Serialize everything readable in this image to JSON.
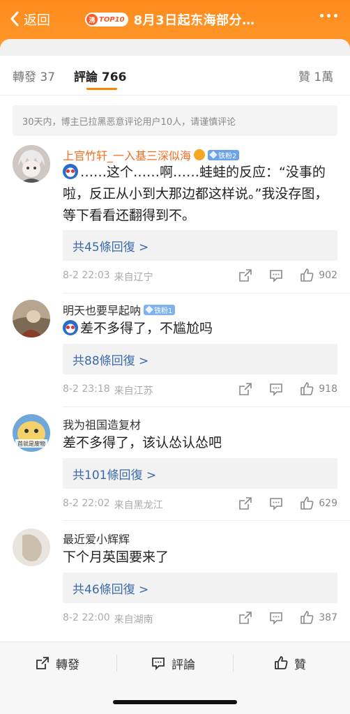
{
  "header": {
    "back_label": "返回",
    "hot_tag": "沸",
    "top10_label": "TOP10",
    "title": "8月3日起东海部分…",
    "colors": {
      "accent": "#ff8a1c"
    }
  },
  "tabs": [
    {
      "label": "轉發 37"
    },
    {
      "label": "評論 766"
    },
    {
      "label": "贊 1萬"
    }
  ],
  "notice": "30天内，博主已拉黑恶意评论用户10人，请谨慎评论",
  "comments": [
    {
      "username": "上官竹轩_一入基三深似海",
      "username_color": "#f36f21",
      "badge": "铁粉2",
      "badge_color": "#6aa3e8",
      "text": "……这个……啊……蛙蛙的反应：“没事的啦，反正从小到大那边都这样说。”我没存图，等下看看还翻得到不。",
      "replies": "共45條回復 >",
      "time": "8-2 22:03",
      "source": "来自辽宁",
      "likes": "902"
    },
    {
      "username": "明天也要早起呐",
      "username_color": "#333333",
      "badge": "铁粉1",
      "badge_color": "#7fb2ef",
      "text": "差不多得了，不尴尬吗",
      "replies": "共88條回復 >",
      "time": "8-2 23:18",
      "source": "来自江苏",
      "likes": "918"
    },
    {
      "username": "我为祖国造复材",
      "username_color": "#333333",
      "text": "差不多得了，该认怂认怂吧",
      "replies": "共101條回復 >",
      "time": "8-2 22:02",
      "source": "来自黑龙江",
      "likes": "629",
      "avatar_caption": "首就是废物"
    },
    {
      "username": "最近爱小辉辉",
      "username_color": "#333333",
      "text": "下个月英国要来了",
      "replies": "共46條回復 >",
      "time": "8-2 22:00",
      "source": "来自湖南",
      "likes": "387"
    }
  ],
  "bottom_bar": {
    "repost_label": "轉發",
    "comment_label": "評論",
    "like_label": "贊"
  }
}
